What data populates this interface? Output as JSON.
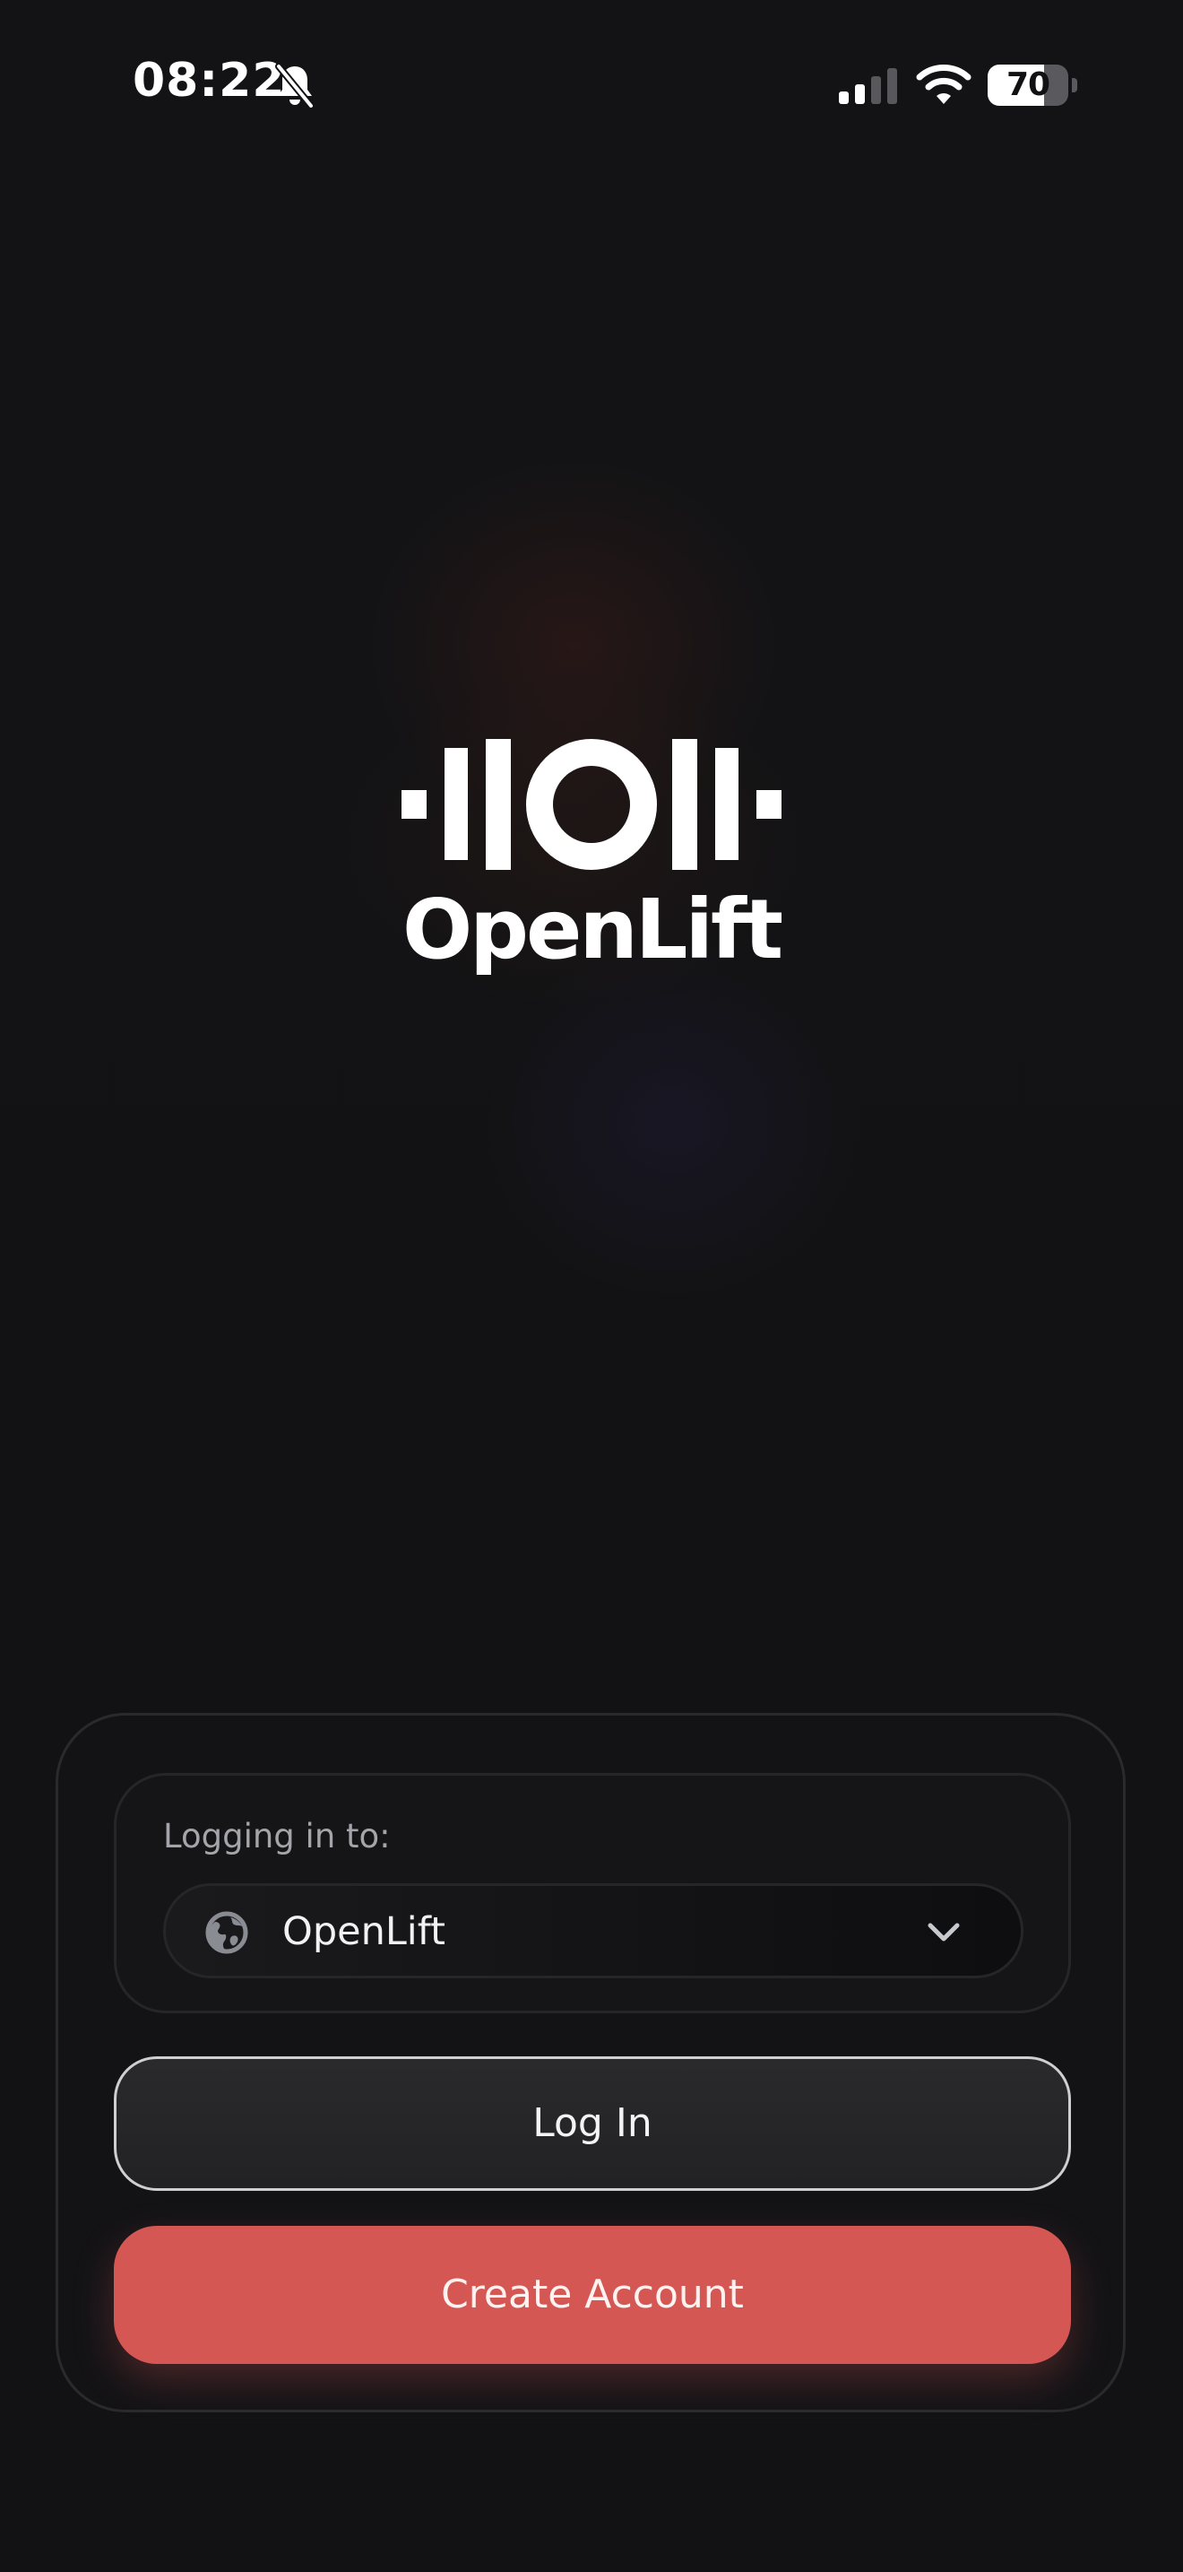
{
  "status_bar": {
    "time": "08:22",
    "battery_percent": 70,
    "battery_label": "70",
    "signal_bars_filled": 2,
    "signal_bars_total": 4,
    "icons": [
      "bell-slash-icon",
      "signal-icon",
      "wifi-icon",
      "battery-icon"
    ]
  },
  "logo": {
    "wordmark": "OpenLift",
    "icon": "barbell-icon"
  },
  "auth": {
    "server_label": "Logging in to:",
    "server_name": "OpenLift",
    "server_icon": "globe-icon",
    "login_label": "Log In",
    "create_account_label": "Create Account"
  },
  "colors": {
    "background": "#121214",
    "accent": "#d55753",
    "muted_text": "#a4a5ab",
    "card_border": "#2a2a2d"
  }
}
